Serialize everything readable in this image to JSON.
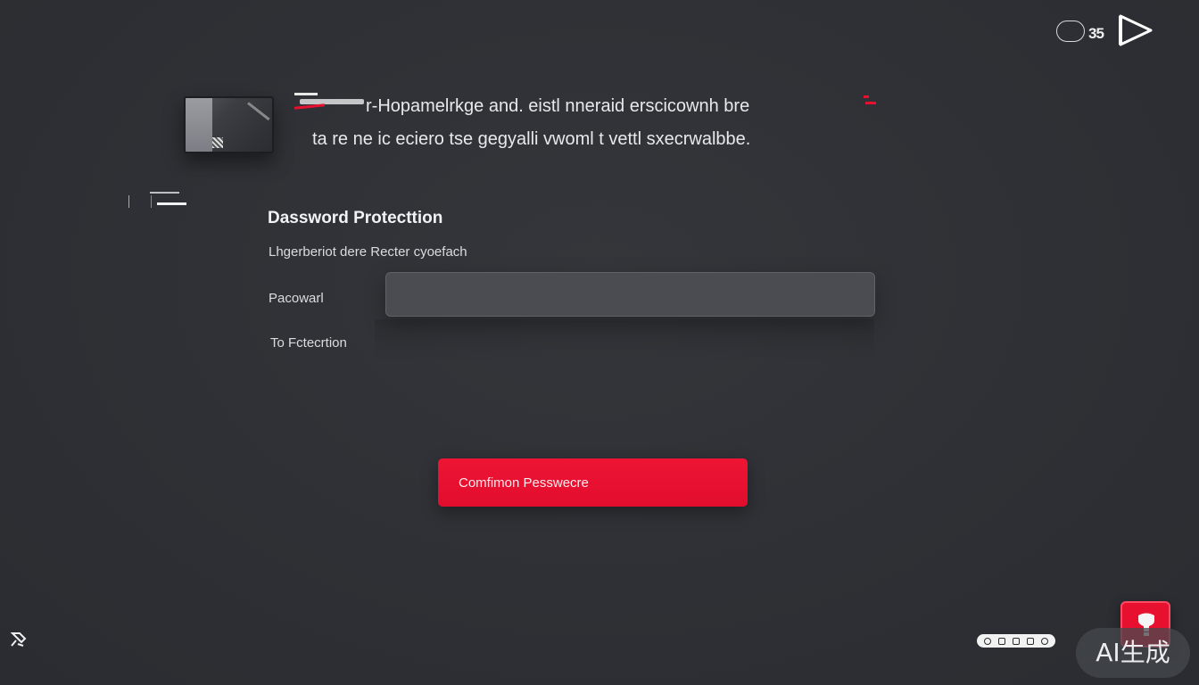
{
  "top_bar": {
    "counter": "35",
    "icons": [
      "cloud-icon",
      "play-icon"
    ]
  },
  "header": {
    "line1": "r-Hopamelrkge and. eistl nneraid erscicownh bre",
    "line2": "ta re ne ic eciero tse gegyalli vwoml t vettl sxecrwalbbe."
  },
  "form": {
    "title": "Dassword Protecttion",
    "description": "Lhgerberiot dere Recter cyoefach",
    "password_label": "Pacowarl",
    "password_value": "",
    "protection_link": "To Fctecrtion"
  },
  "actions": {
    "confirm_label": "Comfimon  Pesswecre"
  },
  "footer": {
    "icons": [
      "pin-icon",
      "status-pill-icons",
      "help-bulb-icon"
    ]
  },
  "watermark": {
    "text": "AI生成"
  },
  "colors": {
    "background": "#2e3035",
    "accent_red": "#e8102f",
    "input_bg": "#4a4c51",
    "text": "#e9e9eb"
  }
}
